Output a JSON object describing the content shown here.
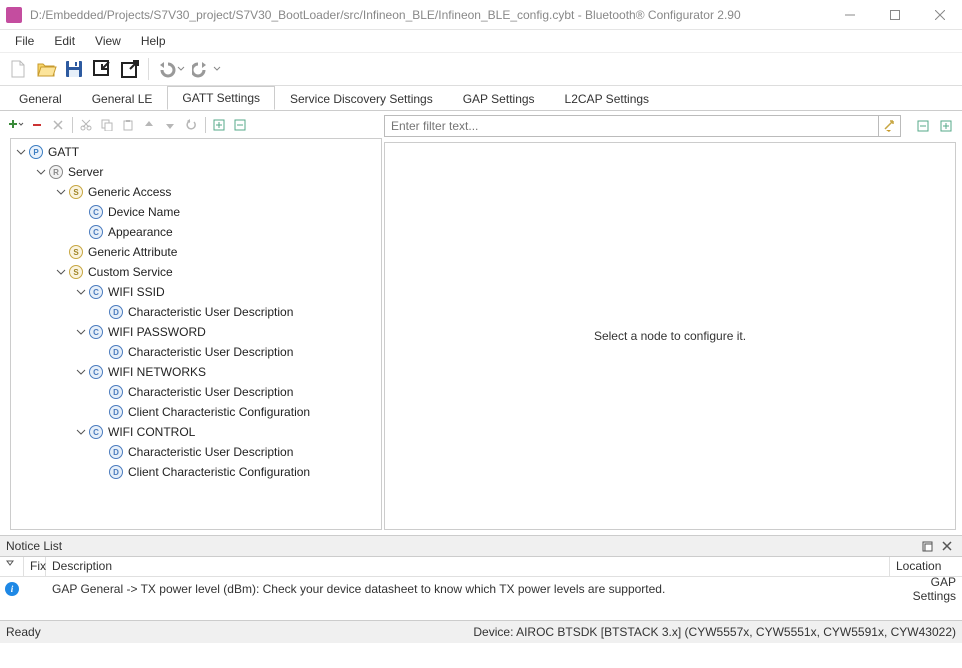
{
  "window": {
    "title": "D:/Embedded/Projects/S7V30_project/S7V30_BootLoader/src/Infineon_BLE/Infineon_BLE_config.cybt - Bluetooth® Configurator 2.90"
  },
  "menu": {
    "file": "File",
    "edit": "Edit",
    "view": "View",
    "help": "Help"
  },
  "tabs": {
    "general": "General",
    "general_le": "General LE",
    "gatt": "GATT Settings",
    "sds": "Service Discovery Settings",
    "gap": "GAP Settings",
    "l2cap": "L2CAP Settings"
  },
  "tree": {
    "gatt": "GATT",
    "server": "Server",
    "generic_access": "Generic Access",
    "device_name": "Device Name",
    "appearance": "Appearance",
    "generic_attribute": "Generic Attribute",
    "custom_service": "Custom Service",
    "wifi_ssid": "WIFI SSID",
    "cud": "Characteristic User Description",
    "wifi_password": "WIFI PASSWORD",
    "wifi_networks": "WIFI NETWORKS",
    "ccc": "Client Characteristic Configuration",
    "wifi_control": "WIFI CONTROL"
  },
  "filter": {
    "placeholder": "Enter filter text..."
  },
  "config_panel": {
    "empty_msg": "Select a node to configure it."
  },
  "notice": {
    "title": "Notice List",
    "col_fix": "Fix",
    "col_desc": "Description",
    "col_loc": "Location",
    "row1_desc": "GAP General -> TX power level (dBm): Check your device datasheet to know which TX power levels are supported.",
    "row1_loc": "GAP Settings"
  },
  "status": {
    "ready": "Ready",
    "device": "Device: AIROC BTSDK [BTSTACK 3.x] (CYW5557x, CYW5551x, CYW5591x, CYW43022)"
  }
}
